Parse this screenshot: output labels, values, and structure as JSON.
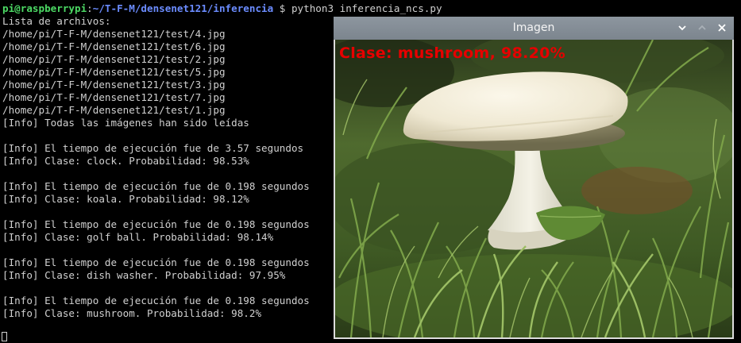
{
  "terminal": {
    "prompt": {
      "user_host": "pi@raspberrypi",
      "sep": ":",
      "path": "~/T-F-M/densenet121/inferencia",
      "symbol": " $ ",
      "command": "python3 inferencia_ncs.py"
    },
    "lines": [
      "Lista de archivos:",
      "/home/pi/T-F-M/densenet121/test/4.jpg",
      "/home/pi/T-F-M/densenet121/test/6.jpg",
      "/home/pi/T-F-M/densenet121/test/2.jpg",
      "/home/pi/T-F-M/densenet121/test/5.jpg",
      "/home/pi/T-F-M/densenet121/test/3.jpg",
      "/home/pi/T-F-M/densenet121/test/7.jpg",
      "/home/pi/T-F-M/densenet121/test/1.jpg",
      "[Info] Todas las imágenes han sido leídas",
      "",
      "[Info] El tiempo de ejecución fue de 3.57 segundos",
      "[Info] Clase: clock. Probabilidad: 98.53%",
      "",
      "[Info] El tiempo de ejecución fue de 0.198 segundos",
      "[Info] Clase: koala. Probabilidad: 98.12%",
      "",
      "[Info] El tiempo de ejecución fue de 0.198 segundos",
      "[Info] Clase: golf ball. Probabilidad: 98.14%",
      "",
      "[Info] El tiempo de ejecución fue de 0.198 segundos",
      "[Info] Clase: dish washer. Probabilidad: 97.95%",
      "",
      "[Info] El tiempo de ejecución fue de 0.198 segundos",
      "[Info] Clase: mushroom. Probabilidad: 98.2%"
    ]
  },
  "image_window": {
    "title": "Imagen",
    "buttons": {
      "minimize": "chevron-down-icon",
      "maximize": "chevron-up-icon",
      "close": "close-icon"
    },
    "overlay_label": "Clase: mushroom, 98.20%",
    "overlay_color": "#e60000"
  }
}
